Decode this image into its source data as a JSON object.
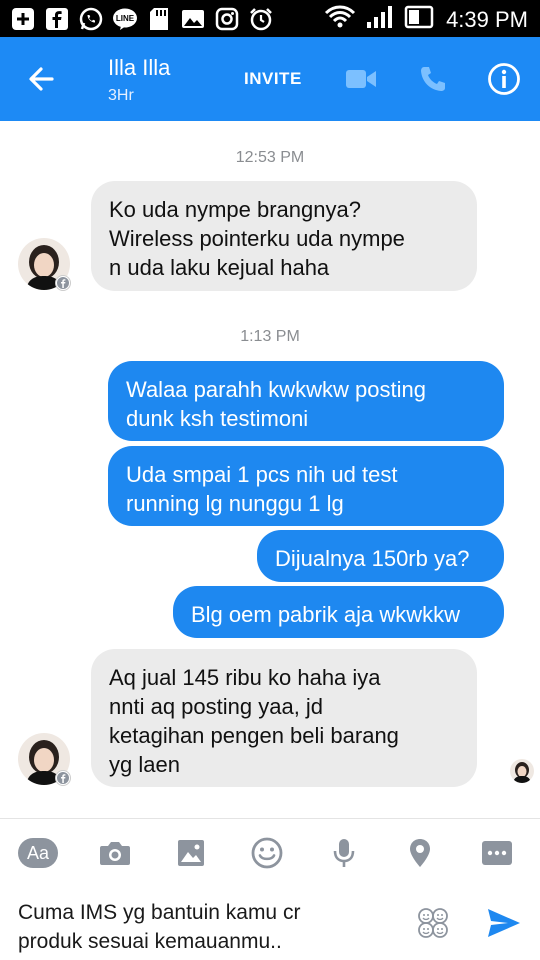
{
  "status_bar": {
    "time": "4:39 PM",
    "icons": [
      "plus-icon",
      "facebook-icon",
      "whatsapp-icon",
      "line-icon",
      "sd-card-icon",
      "gallery-icon",
      "instagram-icon",
      "alarm-icon",
      "wifi-icon",
      "signal-icon",
      "battery-icon"
    ]
  },
  "header": {
    "contact_name": "Illa Illa",
    "contact_status": "3Hr",
    "invite_label": "INVITE",
    "accent_color": "#1d8af5"
  },
  "messages": [
    {
      "kind": "timestamp",
      "text": "12:53 PM"
    },
    {
      "kind": "incoming",
      "lines": [
        "Ko uda nympe brangnya?",
        "Wireless pointerku uda nympe",
        "n uda laku kejual haha"
      ]
    },
    {
      "kind": "timestamp",
      "text": "1:13 PM"
    },
    {
      "kind": "outgoing",
      "lines": [
        "Walaa parahh kwkwkw posting",
        "dunk ksh testimoni"
      ]
    },
    {
      "kind": "outgoing",
      "lines": [
        "Uda smpai 1 pcs nih ud test",
        "running lg nunggu 1 lg"
      ]
    },
    {
      "kind": "outgoing",
      "lines": [
        "Dijualnya 150rb ya?"
      ]
    },
    {
      "kind": "outgoing",
      "lines": [
        "Blg oem pabrik aja wkwkkw"
      ]
    },
    {
      "kind": "incoming",
      "lines": [
        "Aq jual 145 ribu ko haha iya",
        "nnti aq posting yaa, jd",
        "ketagihan pengen beli barang",
        "yg laen"
      ]
    }
  ],
  "composer": {
    "text_lines": [
      "Cuma IMS yg bantuin kamu cr",
      "produk sesuai kemauanmu.."
    ],
    "aa_label": "Aa",
    "tools": [
      "aa-icon",
      "camera-icon",
      "image-icon",
      "smiley-icon",
      "microphone-icon",
      "location-icon",
      "more-icon"
    ]
  }
}
